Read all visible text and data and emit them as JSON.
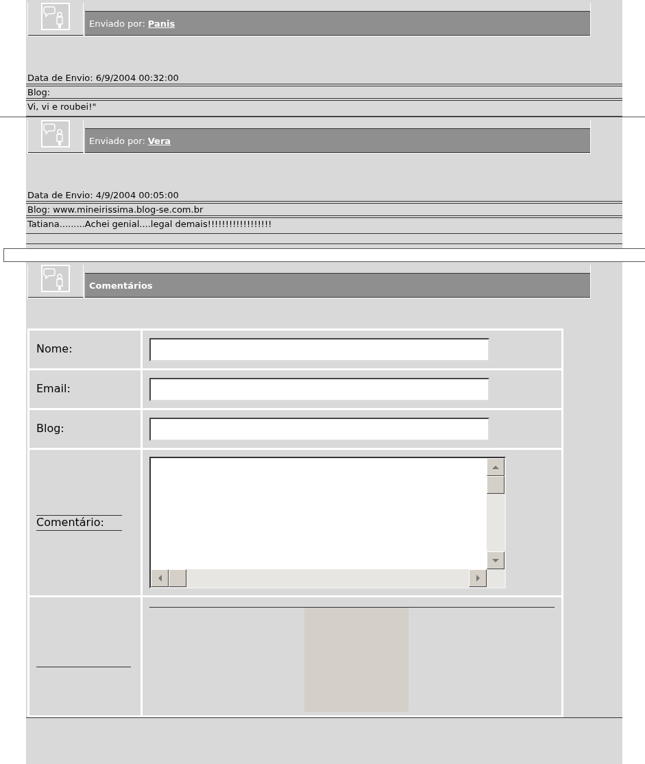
{
  "posts": [
    {
      "author_label": "Enviado por:",
      "author": "Panis",
      "date": "Data de Envio: 6/9/2004 00:32:00",
      "blog": "Blog:",
      "message": "Vi, vi e roubei!\""
    },
    {
      "author_label": "Enviado por:",
      "author": "Vera",
      "date": "Data de Envio: 4/9/2004 00:05:00",
      "blog": "Blog: www.mineirissima.blog-se.com.br",
      "message": "Tatiana.........Achei genial....legal demais!!!!!!!!!!!!!!!!!!"
    }
  ],
  "comments_section": {
    "title": "Comentários",
    "fields": [
      {
        "kind": "text",
        "label": "Nome:"
      },
      {
        "kind": "text",
        "label": "Email:"
      },
      {
        "kind": "text",
        "label": "Blog:"
      },
      {
        "kind": "textarea",
        "label": "Comentário:"
      },
      {
        "kind": "image"
      }
    ]
  }
}
